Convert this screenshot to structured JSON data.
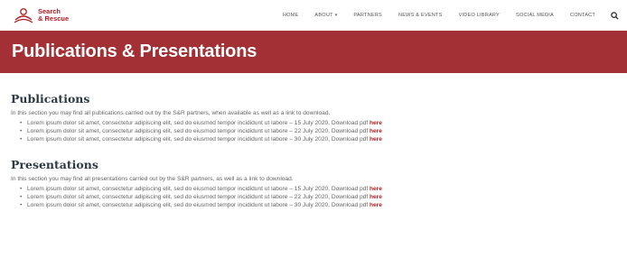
{
  "brand": {
    "line1": "Search",
    "line2": "& Rescue",
    "color": "#b01e23"
  },
  "nav": {
    "items": [
      {
        "label": "HOME"
      },
      {
        "label": "ABOUT",
        "caret": "▾"
      },
      {
        "label": "PARTNERS"
      },
      {
        "label": "NEWS & EVENTS"
      },
      {
        "label": "VIDEO LIBRARY"
      },
      {
        "label": "SOCIAL MEDIA"
      },
      {
        "label": "CONTACT"
      }
    ],
    "search_icon": "search-icon"
  },
  "banner": {
    "title": "Publications & Presentations",
    "color": "#a33034"
  },
  "publications": {
    "heading": "Publications",
    "intro": "In this section you may find all publications carried out by the S&R partners, when available as well as a link to download.",
    "items": [
      {
        "text": "Lorem ipsum dolor sit amet, consectetur adipiscing elit, sed do eiusmod tempor incididunt ut labore – 15 July 2020, Download pdf ",
        "link": "here"
      },
      {
        "text": "Lorem ipsum dolor sit amet, consectetur adipiscing elit, sed do eiusmod tempor incididunt ut labore – 22 July 2020, Download pdf ",
        "link": "here"
      },
      {
        "text": "Lorem ipsum dolor sit amet, consectetur adipiscing elit, sed do eiusmod tempor incididunt ut labore – 30 July 2020, Download pdf ",
        "link": "here"
      }
    ]
  },
  "presentations": {
    "heading": "Presentations",
    "intro": "In this section you may find all presentations carried out by the S&R partners, as well as a link to download.",
    "items": [
      {
        "text": "Lorem ipsum dolor sit amet, consectetur adipiscing elit, sed do eiusmod tempor incididunt ut labore – 15 July 2020, Download pdf ",
        "link": "here"
      },
      {
        "text": "Lorem ipsum dolor sit amet, consectetur adipiscing elit, sed do eiusmod tempor incididunt ut labore – 22 July 2020, Download pdf ",
        "link": "here"
      },
      {
        "text": "Lorem ipsum dolor sit amet, consectetur adipiscing elit, sed do eiusmod tempor incididunt ut labore – 30 July 2020, Download pdf ",
        "link": "here"
      }
    ]
  }
}
